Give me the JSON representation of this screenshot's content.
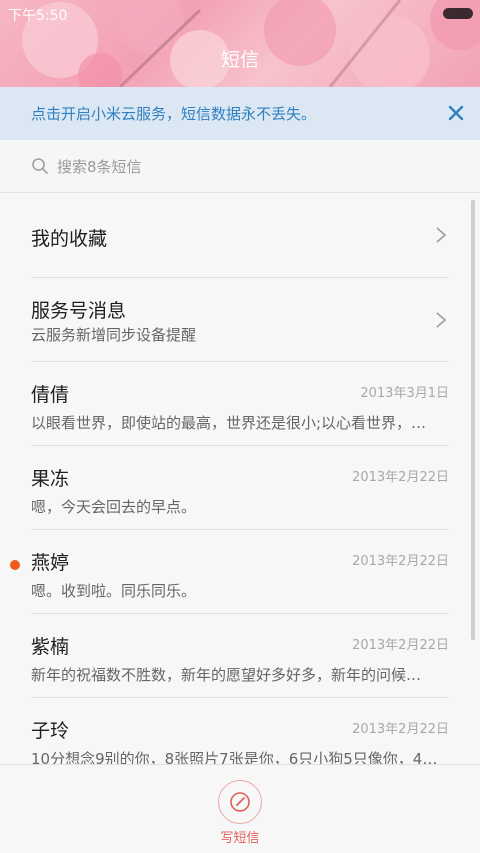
{
  "status_bar": {
    "time": "下午5:50"
  },
  "header": {
    "title": "短信"
  },
  "banner": {
    "text": "点击开启小米云服务，短信数据永不丢失。",
    "accent": "#2f7fc1"
  },
  "search": {
    "placeholder": "搜索8条短信"
  },
  "list": [
    {
      "name": "我的收藏",
      "type": "folder"
    },
    {
      "name": "服务号消息",
      "subtitle": "云服务新增同步设备提醒",
      "type": "folder"
    },
    {
      "name": "倩倩",
      "date": "2013年3月1日",
      "preview": "以眼看世界，即使站的最高，世界还是很小;以心看世界，…"
    },
    {
      "name": "果冻",
      "date": "2013年2月22日",
      "preview": "嗯，今天会回去的早点。"
    },
    {
      "name": "燕婷",
      "date": "2013年2月22日",
      "preview": "嗯。收到啦。同乐同乐。",
      "unread": true
    },
    {
      "name": "紫楠",
      "date": "2013年2月22日",
      "preview": "新年的祝福数不胜数，新年的愿望好多好多，新年的问候…"
    },
    {
      "name": "子玲",
      "date": "2013年2月22日",
      "preview": "10分想念9别的你，8张照片7张是你，6只小狗5只像你，4…"
    }
  ],
  "bottom": {
    "compose_label": "写短信"
  },
  "colors": {
    "unread_dot": "#f05a1a",
    "compose": "#e0605b"
  }
}
